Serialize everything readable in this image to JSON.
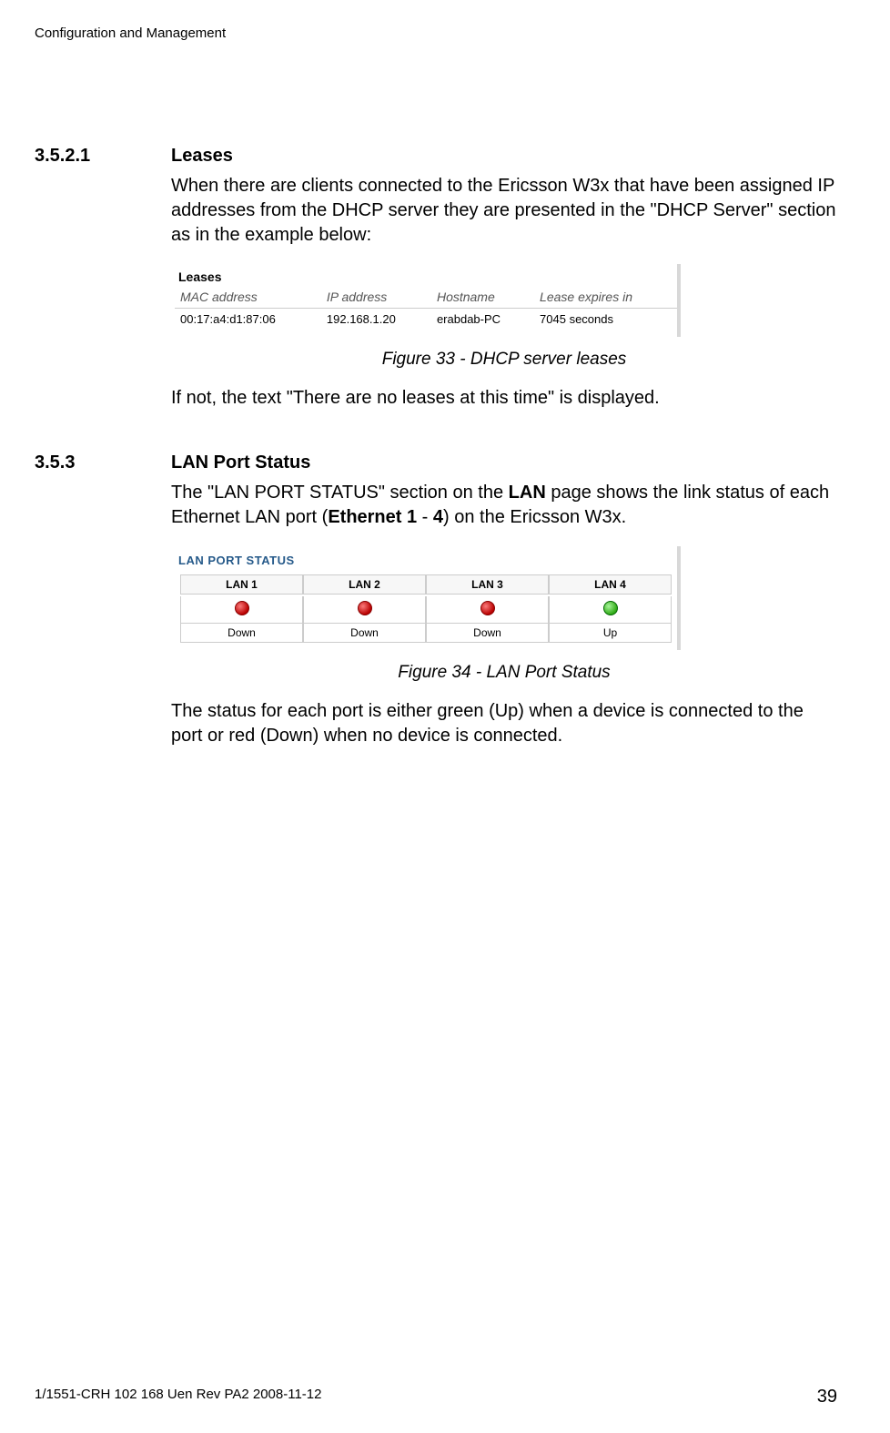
{
  "header": {
    "title": "Configuration and Management"
  },
  "section1": {
    "number": "3.5.2.1",
    "title": "Leases",
    "para1": "When there are clients connected to the Ericsson W3x that have been assigned IP addresses from the DHCP server they are presented in the \"DHCP Server\" section as in the example below:",
    "caption": "Figure 33 - DHCP server leases",
    "para2": "If not, the text \"There are no leases at this time\" is displayed."
  },
  "leases": {
    "heading": "Leases",
    "columns": {
      "mac": "MAC address",
      "ip": "IP address",
      "host": "Hostname",
      "expires": "Lease expires in"
    },
    "row": {
      "mac": "00:17:a4:d1:87:06",
      "ip": "192.168.1.20",
      "host": "erabdab-PC",
      "expires": "7045 seconds"
    }
  },
  "section2": {
    "number": "3.5.3",
    "title": "LAN Port Status",
    "para1_pre": "The \"LAN PORT STATUS\" section on the ",
    "para1_bold1": "LAN",
    "para1_mid": " page shows the link status of each Ethernet LAN port (",
    "para1_bold2": "Ethernet 1",
    "para1_dash": " - ",
    "para1_bold3": "4",
    "para1_post": ") on the Ericsson W3x.",
    "caption": "Figure 34 - LAN Port Status",
    "para2": "The status for each port is either green (Up) when a device is connected to the port or red (Down) when no device is connected."
  },
  "lanstatus": {
    "heading": "LAN PORT STATUS",
    "ports": {
      "h1": "LAN 1",
      "h2": "LAN 2",
      "h3": "LAN 3",
      "h4": "LAN 4",
      "s1": "Down",
      "s2": "Down",
      "s3": "Down",
      "s4": "Up"
    }
  },
  "footer": {
    "left": "1/1551-CRH 102 168 Uen Rev PA2  2008-11-12",
    "right": "39"
  }
}
